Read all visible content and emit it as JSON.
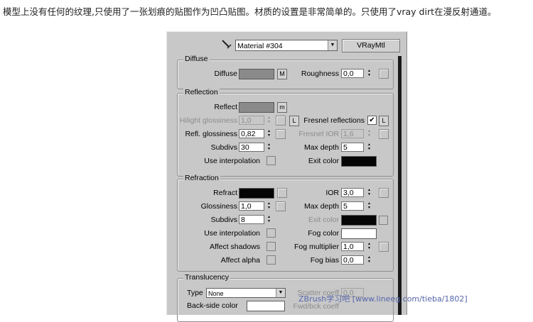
{
  "caption": "模型上没有任何的纹理,只使用了一张划痕的贴图作为凹凸贴图。材质的设置是非常简单的。只使用了vray dirt在漫反射通道。",
  "header": {
    "material_name": "Material #304",
    "material_type": "VRayMtl",
    "eyedropper_icon": "eyedropper-icon"
  },
  "diffuse": {
    "title": "Diffuse",
    "diffuse_label": "Diffuse",
    "diffuse_color": "#8a8a8a",
    "map_button": "M",
    "roughness_label": "Roughness",
    "roughness_value": "0,0"
  },
  "reflection": {
    "title": "Reflection",
    "reflect_label": "Reflect",
    "reflect_color": "#8a8a8a",
    "map_button": "m",
    "hilight_label": "Hilight glossiness",
    "hilight_value": "1,0",
    "lock_button": "L",
    "fresnel_label": "Fresnel reflections",
    "fresnel_checked": "✔",
    "fresnel_lock": "L",
    "refl_gloss_label": "Refl. glossiness",
    "refl_gloss_value": "0,82",
    "fresnel_ior_label": "Fresnel IOR",
    "fresnel_ior_value": "1,6",
    "subdivs_label": "Subdivs",
    "subdivs_value": "30",
    "max_depth_label": "Max depth",
    "max_depth_value": "5",
    "use_interp_label": "Use interpolation",
    "exit_color_label": "Exit color",
    "exit_color": "#050505"
  },
  "refraction": {
    "title": "Refraction",
    "refract_label": "Refract",
    "refract_color": "#050505",
    "ior_label": "IOR",
    "ior_value": "3,0",
    "gloss_label": "Glossiness",
    "gloss_value": "1,0",
    "max_depth_label": "Max depth",
    "max_depth_value": "5",
    "subdivs_label": "Subdivs",
    "subdivs_value": "8",
    "exit_color_label": "Exit color",
    "exit_color": "#050505",
    "use_interp_label": "Use interpolation",
    "fog_color_label": "Fog color",
    "fog_color": "#ffffff",
    "affect_shadows_label": "Affect shadows",
    "fog_mult_label": "Fog multiplier",
    "fog_mult_value": "1,0",
    "affect_alpha_label": "Affect alpha",
    "fog_bias_label": "Fog bias",
    "fog_bias_value": "0,0"
  },
  "translucency": {
    "title": "Translucency",
    "type_label": "Type",
    "type_value": "None",
    "scatter_label": "Scatter coeff",
    "scatter_value": "0,0",
    "backside_label": "Back-side color",
    "backside_color": "#ffffff",
    "fwd_back_label": "Fwd/bck coeff"
  },
  "watermark": "ZBrush学习吧 [www.lineeg.com/tieba/1802]"
}
